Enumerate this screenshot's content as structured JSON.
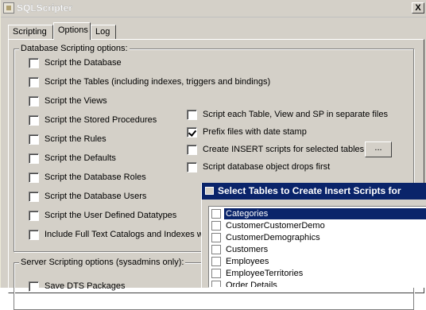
{
  "window": {
    "title": "SQLScripter",
    "close_label": "X"
  },
  "tabs": [
    {
      "label": "Scripting"
    },
    {
      "label": "Options"
    },
    {
      "label": "Log"
    }
  ],
  "database_group": {
    "label": "Database Scripting options:",
    "options": [
      {
        "label": "Script the Database",
        "checked": false
      },
      {
        "label": "Script the Tables (including indexes, triggers and bindings)",
        "checked": false
      },
      {
        "label": "Script the Views",
        "checked": false
      },
      {
        "label": "Script the Stored Procedures",
        "checked": false
      },
      {
        "label": "Script the Rules",
        "checked": false
      },
      {
        "label": "Script the Defaults",
        "checked": false
      },
      {
        "label": "Script the Database Roles",
        "checked": false
      },
      {
        "label": "Script the Database Users",
        "checked": false
      },
      {
        "label": "Script the User Defined Datatypes",
        "checked": false
      },
      {
        "label": "Include Full Text Catalogs and Indexes wi",
        "checked": false
      }
    ],
    "right_options": [
      {
        "label": "Script each Table, View and SP in separate files",
        "checked": false
      },
      {
        "label": "Prefix files with date stamp",
        "checked": true
      },
      {
        "label": "Create INSERT scripts for selected tables",
        "checked": false
      },
      {
        "label": "Script database object drops first",
        "checked": false
      }
    ],
    "browse_label": "..."
  },
  "server_group": {
    "label": "Server Scripting options (sysadmins only):",
    "options": [
      {
        "label": "Save DTS Packages",
        "checked": false
      }
    ]
  },
  "dialog": {
    "title": "Select Tables to Create Insert Scripts for",
    "tables": [
      {
        "name": "Categories",
        "checked": false,
        "selected": true
      },
      {
        "name": "CustomerCustomerDemo",
        "checked": false,
        "selected": false
      },
      {
        "name": "CustomerDemographics",
        "checked": false,
        "selected": false
      },
      {
        "name": "Customers",
        "checked": false,
        "selected": false
      },
      {
        "name": "Employees",
        "checked": false,
        "selected": false
      },
      {
        "name": "EmployeeTerritories",
        "checked": false,
        "selected": false
      },
      {
        "name": "Order Details",
        "checked": false,
        "selected": false
      }
    ]
  }
}
